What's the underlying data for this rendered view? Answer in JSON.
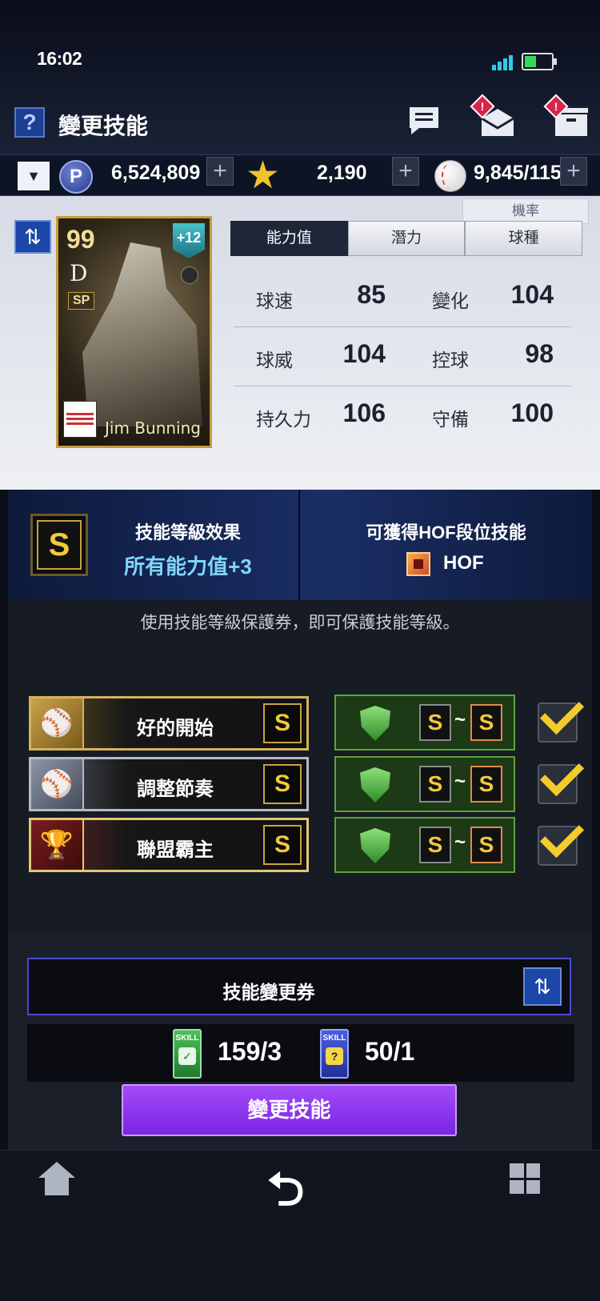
{
  "status": {
    "time": "16:02"
  },
  "header": {
    "help_icon": "?",
    "title": "變更技能"
  },
  "currency": {
    "points": "6,524,809",
    "points_icon": "P",
    "stars": "2,190",
    "balls": "9,845/115"
  },
  "panel": {
    "rate_label": "機率",
    "card": {
      "ovr": "99",
      "team_logo": "D",
      "type": "SP",
      "plus": "+12",
      "name": "Jim Bunning"
    },
    "tabs": [
      "能力值",
      "潛力",
      "球種"
    ],
    "stats": [
      {
        "l1": "球速",
        "v1": "85",
        "l2": "變化",
        "v2": "104"
      },
      {
        "l1": "球威",
        "v1": "104",
        "l2": "控球",
        "v2": "98"
      },
      {
        "l1": "持久力",
        "v1": "106",
        "l2": "守備",
        "v2": "100"
      }
    ]
  },
  "effects": {
    "grade": "S",
    "left_title": "技能等級效果",
    "left_value": "所有能力值+3",
    "right_title": "可獲得HOF段位技能",
    "right_value": "HOF"
  },
  "notice": "使用技能等級保護券，即可保護技能等級。",
  "skills": [
    {
      "name": "好的開始",
      "grade": "S",
      "from": "S",
      "to": "S",
      "checked": true
    },
    {
      "name": "調整節奏",
      "grade": "S",
      "from": "S",
      "to": "S",
      "checked": true
    },
    {
      "name": "聯盟霸主",
      "grade": "S",
      "from": "S",
      "to": "S",
      "checked": true
    }
  ],
  "tickets": {
    "label": "技能變更券",
    "ticket1_tag": "SKILL",
    "ticket1_count": "159/3",
    "ticket2_tag": "SKILL",
    "ticket2_count": "50/1"
  },
  "main_button": "變更技能",
  "nav": {
    "back_icon": "⮌"
  }
}
